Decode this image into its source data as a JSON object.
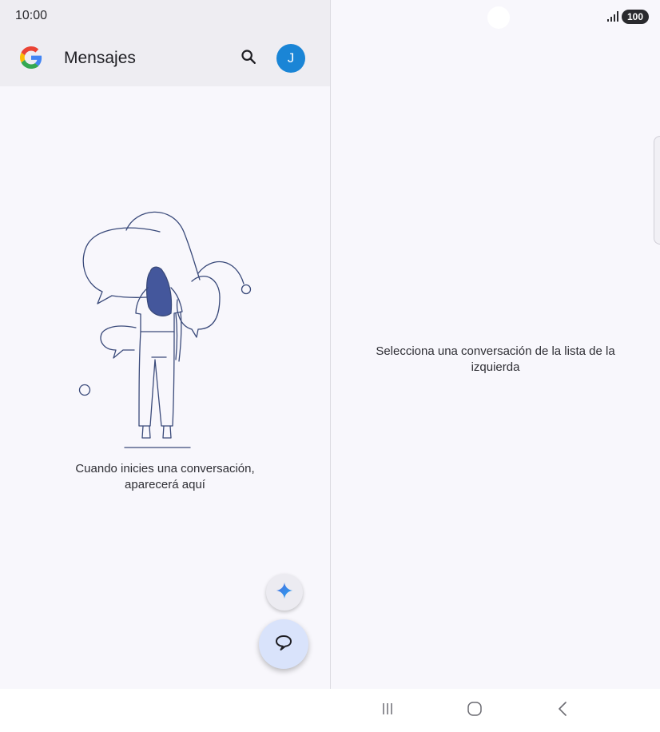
{
  "status_bar": {
    "time": "10:00",
    "battery": "100",
    "icons": [
      "signal-icon",
      "battery-icon"
    ]
  },
  "app_bar": {
    "title": "Mensajes",
    "avatar_initial": "J",
    "icons": [
      "google-logo-icon",
      "search-icon"
    ]
  },
  "conversation_list": {
    "empty_message_line1": "Cuando inicies una conversación,",
    "empty_message_line2": "aparecerá aquí"
  },
  "detail_pane": {
    "message": "Selecciona una conversación de la lista de la izquierda"
  },
  "fabs": {
    "gemini_icon": "sparkle-icon",
    "new_chat_icon": "chat-bubble-icon"
  },
  "nav_bar": {
    "icons": [
      "recent-apps-icon",
      "home-icon",
      "back-icon"
    ]
  },
  "colors": {
    "avatar": "#1a85d6",
    "fab_main": "#d9e3fb",
    "illustration_stroke": "#3a4a7a",
    "illustration_fill": "#44579c"
  }
}
